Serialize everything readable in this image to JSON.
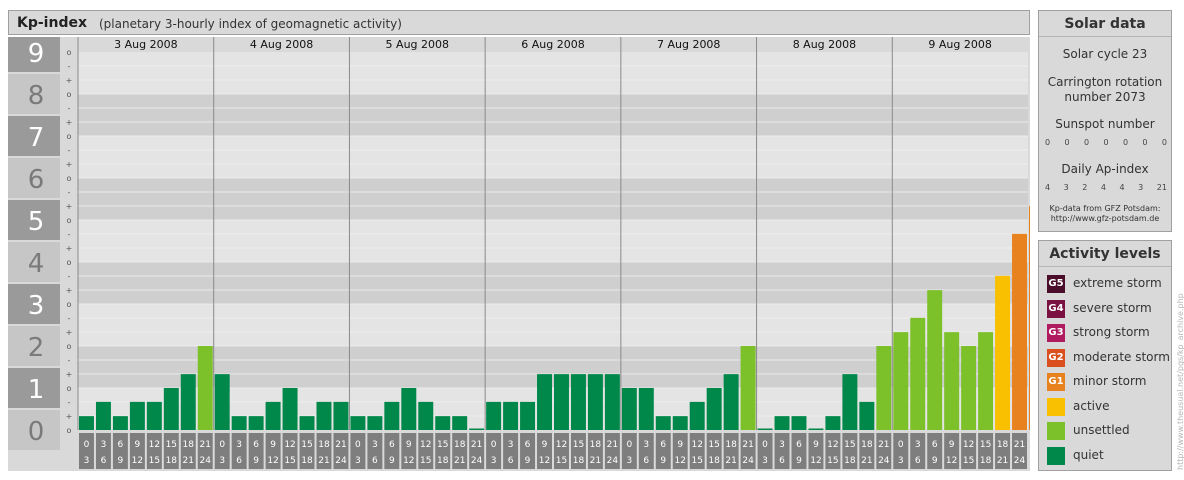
{
  "header": {
    "title": "Kp-index",
    "subtitle": "(planetary 3-hourly index of geomagnetic activity)"
  },
  "chart_data": {
    "type": "bar",
    "title": "Kp-index",
    "y_major_ticks": [
      "9",
      "8",
      "7",
      "6",
      "5",
      "4",
      "3",
      "2",
      "1",
      "0"
    ],
    "y_minor_ticks": [
      "o",
      "-",
      "+",
      "o",
      "-",
      "+",
      "o",
      "-",
      "+",
      "o",
      "-",
      "+",
      "o",
      "-",
      "+",
      "o",
      "-",
      "+",
      "o",
      "-",
      "+",
      "o",
      "-",
      "+",
      "o",
      "-",
      "+",
      "o"
    ],
    "ylim": [
      0,
      9
    ],
    "days": [
      "3 Aug 2008",
      "4 Aug 2008",
      "5 Aug 2008",
      "6 Aug 2008",
      "7 Aug 2008",
      "8 Aug 2008",
      "9 Aug 2008"
    ],
    "interval_start_hours": [
      "0",
      "3",
      "6",
      "9",
      "12",
      "15",
      "18",
      "21"
    ],
    "interval_end_hours": [
      "3",
      "6",
      "9",
      "12",
      "15",
      "18",
      "21",
      "24"
    ],
    "values": [
      0.33,
      0.67,
      0.33,
      0.67,
      0.67,
      1,
      1.33,
      2,
      1.33,
      0.33,
      0.33,
      0.67,
      1,
      0.33,
      0.67,
      0.67,
      0.33,
      0.33,
      0.67,
      1,
      0.67,
      0.33,
      0.33,
      0,
      0.67,
      0.67,
      0.67,
      1.33,
      1.33,
      1.33,
      1.33,
      1.33,
      1,
      1,
      0.33,
      0.33,
      0.67,
      1,
      1.33,
      2,
      0,
      0.33,
      0.33,
      0,
      0.33,
      1.33,
      0.67,
      2,
      2.33,
      2.67,
      3.33,
      2.33,
      2,
      2.33,
      3.67,
      4.67,
      5.33
    ],
    "categories": [
      "3 Aug 2008 0-3",
      "3 Aug 2008 3-6",
      "3 Aug 2008 6-9",
      "3 Aug 2008 9-12",
      "3 Aug 2008 12-15",
      "3 Aug 2008 15-18",
      "3 Aug 2008 18-21",
      "3 Aug 2008 21-24",
      "4 Aug 2008 0-3",
      "4 Aug 2008 3-6",
      "4 Aug 2008 6-9",
      "4 Aug 2008 9-12",
      "4 Aug 2008 12-15",
      "4 Aug 2008 15-18",
      "4 Aug 2008 18-21",
      "4 Aug 2008 21-24",
      "5 Aug 2008 0-3",
      "5 Aug 2008 3-6",
      "5 Aug 2008 6-9",
      "5 Aug 2008 9-12",
      "5 Aug 2008 12-15",
      "5 Aug 2008 15-18",
      "5 Aug 2008 18-21",
      "5 Aug 2008 21-24",
      "6 Aug 2008 0-3",
      "6 Aug 2008 3-6",
      "6 Aug 2008 6-9",
      "6 Aug 2008 9-12",
      "6 Aug 2008 12-15",
      "6 Aug 2008 15-18",
      "6 Aug 2008 18-21",
      "6 Aug 2008 21-24",
      "7 Aug 2008 0-3",
      "7 Aug 2008 3-6",
      "7 Aug 2008 6-9",
      "7 Aug 2008 9-12",
      "7 Aug 2008 12-15",
      "7 Aug 2008 15-18",
      "7 Aug 2008 18-21",
      "7 Aug 2008 21-24",
      "8 Aug 2008 0-3",
      "8 Aug 2008 3-6",
      "8 Aug 2008 6-9",
      "8 Aug 2008 9-12",
      "8 Aug 2008 12-15",
      "8 Aug 2008 15-18",
      "8 Aug 2008 18-21",
      "8 Aug 2008 21-24",
      "9 Aug 2008 0-3",
      "9 Aug 2008 3-6",
      "9 Aug 2008 6-9",
      "9 Aug 2008 9-12",
      "9 Aug 2008 12-15",
      "9 Aug 2008 15-18",
      "9 Aug 2008 18-21",
      "9 Aug 2008 21-24"
    ],
    "grid": true,
    "legend": "right"
  },
  "solar": {
    "title": "Solar data",
    "cycle": "Solar cycle 23",
    "carrington_line1": "Carrington rotation",
    "carrington_line2": "number 2073",
    "sunspot_label": "Sunspot number",
    "sunspot_values": [
      "0",
      "0",
      "0",
      "0",
      "0",
      "0",
      "0"
    ],
    "ap_label": "Daily Ap-index",
    "ap_values": [
      "4",
      "3",
      "2",
      "4",
      "4",
      "3",
      "21"
    ],
    "source_line1": "Kp-data from GFZ Potsdam:",
    "source_line2": "http://www.gfz-potsdam.de"
  },
  "activity": {
    "title": "Activity levels",
    "levels": [
      {
        "badge": "G5",
        "label": "extreme storm",
        "color": "#4a0e2a"
      },
      {
        "badge": "G4",
        "label": "severe storm",
        "color": "#7b1042"
      },
      {
        "badge": "G3",
        "label": "strong storm",
        "color": "#b01a5e"
      },
      {
        "badge": "G2",
        "label": "moderate storm",
        "color": "#d9501e"
      },
      {
        "badge": "G1",
        "label": "minor storm",
        "color": "#e8821e"
      },
      {
        "badge": "",
        "label": "active",
        "color": "#f8c000"
      },
      {
        "badge": "",
        "label": "unsettled",
        "color": "#7cc02a"
      },
      {
        "badge": "",
        "label": "quiet",
        "color": "#00874a"
      }
    ]
  },
  "colors": {
    "quiet": "#00874a",
    "unsettled": "#7cc02a",
    "active": "#f8c000",
    "minor_storm": "#e8821e"
  },
  "watermark": "http://www.theusual.net/pgs/kp_archive.php"
}
